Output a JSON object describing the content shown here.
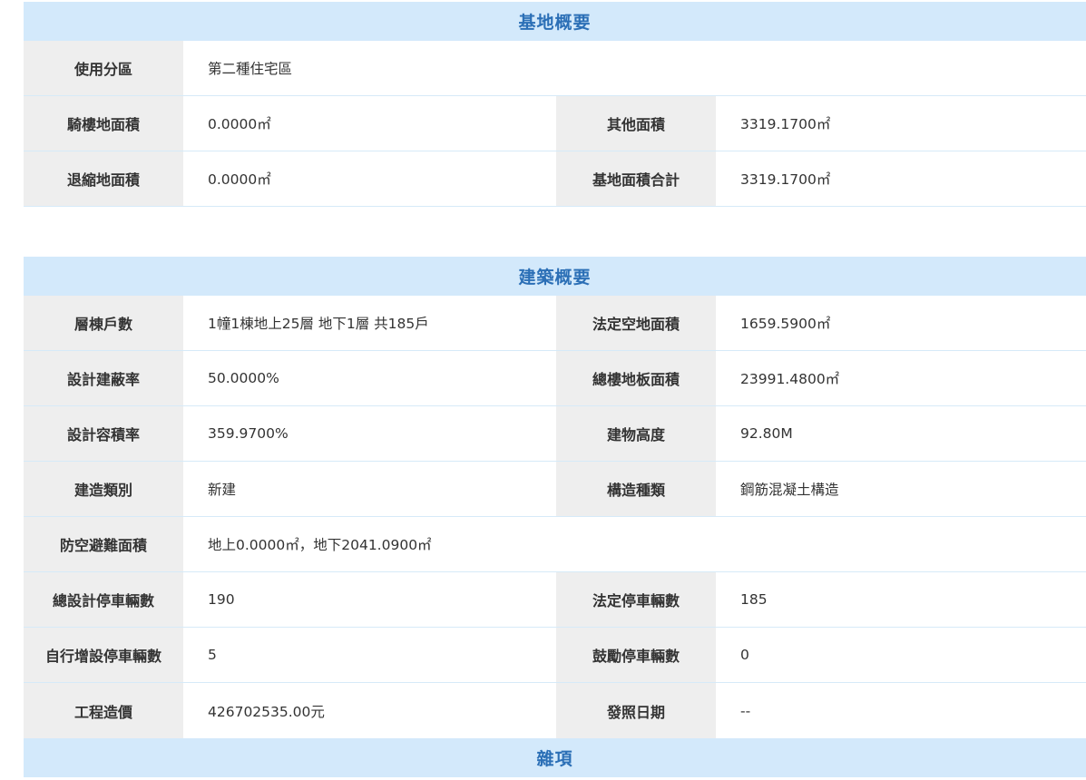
{
  "site": {
    "title": "基地概要",
    "zoning": {
      "label": "使用分區",
      "value": "第二種住宅區"
    },
    "arcade_area": {
      "label": "騎樓地面積",
      "value": "0.0000㎡"
    },
    "other_area": {
      "label": "其他面積",
      "value": "3319.1700㎡"
    },
    "setback_area": {
      "label": "退縮地面積",
      "value": "0.0000㎡"
    },
    "total_area": {
      "label": "基地面積合計",
      "value": "3319.1700㎡"
    }
  },
  "building": {
    "title": "建築概要",
    "floors_units": {
      "label": "層棟戶數",
      "value": "1幢1棟地上25層 地下1層 共185戶"
    },
    "open_space": {
      "label": "法定空地面積",
      "value": "1659.5900㎡"
    },
    "coverage": {
      "label": "設計建蔽率",
      "value": "50.0000%"
    },
    "floor_area": {
      "label": "總樓地板面積",
      "value": "23991.4800㎡"
    },
    "far": {
      "label": "設計容積率",
      "value": "359.9700%"
    },
    "height": {
      "label": "建物高度",
      "value": "92.80M"
    },
    "build_type": {
      "label": "建造類別",
      "value": "新建"
    },
    "structure": {
      "label": "構造種類",
      "value": "鋼筋混凝土構造"
    },
    "shelter": {
      "label": "防空避難面積",
      "value": "地上0.0000㎡，地下2041.0900㎡"
    },
    "total_parking": {
      "label": "總設計停車輛數",
      "value": "190"
    },
    "legal_parking": {
      "label": "法定停車輛數",
      "value": "185"
    },
    "added_parking": {
      "label": "自行增設停車輛數",
      "value": "5"
    },
    "incentive_parking": {
      "label": "鼓勵停車輛數",
      "value": "0"
    },
    "cost": {
      "label": "工程造價",
      "value": "426702535.00元"
    },
    "permit_date": {
      "label": "發照日期",
      "value": "--"
    }
  },
  "misc": {
    "title": "雜項"
  }
}
